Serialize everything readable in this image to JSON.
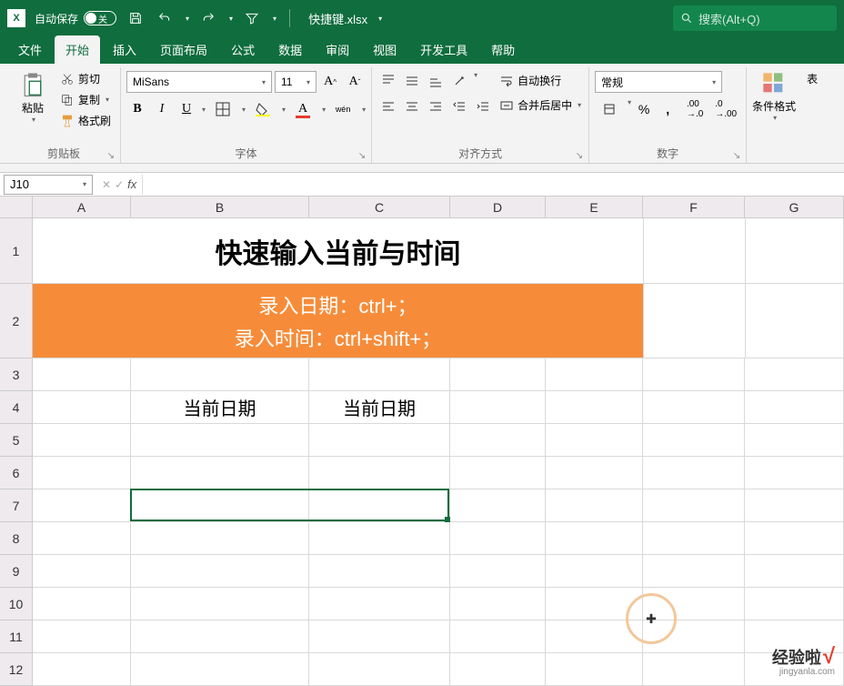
{
  "titlebar": {
    "autosave_label": "自动保存",
    "autosave_state": "关",
    "filename": "快捷键.xlsx",
    "search_placeholder": "搜索(Alt+Q)"
  },
  "tabs": {
    "file": "文件",
    "home": "开始",
    "insert": "插入",
    "pagelayout": "页面布局",
    "formulas": "公式",
    "data": "数据",
    "review": "审阅",
    "view": "视图",
    "developer": "开发工具",
    "help": "帮助"
  },
  "ribbon": {
    "clipboard": {
      "paste": "粘贴",
      "cut": "剪切",
      "copy": "复制",
      "format_painter": "格式刷",
      "label": "剪贴板"
    },
    "font": {
      "name": "MiSans",
      "size": "11",
      "wen": "wén",
      "label": "字体"
    },
    "alignment": {
      "wrap": "自动换行",
      "merge": "合并后居中",
      "label": "对齐方式"
    },
    "number": {
      "format": "常规",
      "label": "数字"
    },
    "conditional": {
      "label": "条件格式",
      "label2": "表"
    }
  },
  "formula_bar": {
    "name_box": "J10",
    "fx": "fx"
  },
  "columns": [
    "A",
    "B",
    "C",
    "D",
    "E",
    "F",
    "G"
  ],
  "rows": [
    "1",
    "2",
    "3",
    "4",
    "5",
    "6",
    "7",
    "8",
    "9",
    "10",
    "11",
    "12"
  ],
  "sheet": {
    "title": "快速输入当前与时间",
    "line1": "录入日期：ctrl+；",
    "line2": "录入时间：ctrl+shift+；",
    "b4": "当前日期",
    "c4": "当前日期"
  },
  "watermark": {
    "text1": "经验啦",
    "text2": "√",
    "sub": "jingyanla.com"
  }
}
